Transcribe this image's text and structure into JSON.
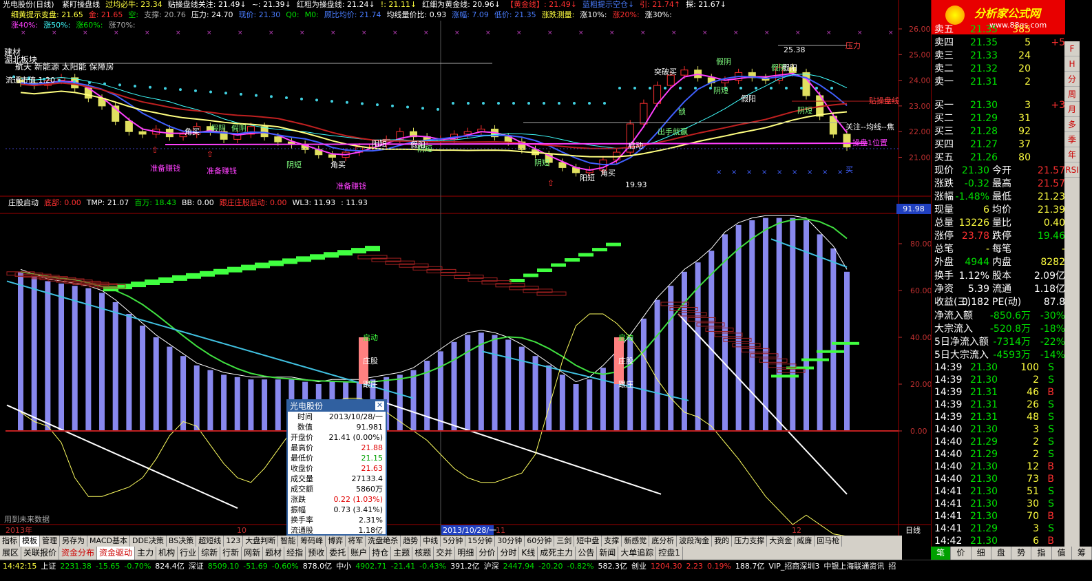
{
  "header": {
    "title": "光电股份(日线)",
    "line1": [
      {
        "t": "紧盯操盘线",
        "c": "wht"
      },
      {
        "t": "过均必牛: 23.34",
        "c": "yel"
      },
      {
        "t": "贴操盘线关注: 21.49↓",
        "c": "wht"
      },
      {
        "t": "~: 21.39↓",
        "c": "wht"
      },
      {
        "t": "红粗为操盘线: 21.24↓",
        "c": "wht"
      },
      {
        "t": "!: 21.11↓",
        "c": "yel"
      },
      {
        "t": "红细为黄金线: 20.96↓",
        "c": "wht"
      },
      {
        "t": "【黄金线】: 21.49↓",
        "c": "red"
      },
      {
        "t": "蓝粗提示空仓↓",
        "c": "blu"
      },
      {
        "t": "引: 21.74↑",
        "c": "red"
      },
      {
        "t": "探: 21.67↓",
        "c": "wht"
      }
    ],
    "line2": [
      {
        "t": "细黄提示变盘: 21.65",
        "c": "yel"
      },
      {
        "t": "金: 21.65",
        "c": "red"
      },
      {
        "t": "空:",
        "c": "grn"
      },
      {
        "t": "支撑: 20.76",
        "c": "gry"
      },
      {
        "t": "压力: 24.70",
        "c": "wht"
      },
      {
        "t": "现价: 21.30",
        "c": "blu"
      },
      {
        "t": "Q0:",
        "c": "grn"
      },
      {
        "t": "M0:",
        "c": "grn"
      },
      {
        "t": "顾比均价: 21.74",
        "c": "blu"
      },
      {
        "t": "均线量价比: 0.93",
        "c": "wht"
      },
      {
        "t": "涨幅: 7.09",
        "c": "blu"
      },
      {
        "t": "低价: 21.35",
        "c": "blu"
      },
      {
        "t": "涨跌测量:",
        "c": "yel"
      },
      {
        "t": "涨10%:",
        "c": "wht"
      },
      {
        "t": "涨20%:",
        "c": "red"
      },
      {
        "t": "涨30%:",
        "c": "wht"
      }
    ],
    "line3": [
      {
        "t": "涨40%:",
        "c": "mag"
      },
      {
        "t": "涨50%:",
        "c": "cyn"
      },
      {
        "t": "涨60%:",
        "c": "grn"
      },
      {
        "t": "涨70%:",
        "c": "gry"
      }
    ]
  },
  "overlay_texts": {
    "sector1": "建材",
    "sector2": "湖北板块",
    "concepts": "航天 新能源 太阳能 保障房",
    "note": "流通市值 1.20",
    "future_data": "用到未来数据"
  },
  "indicator_header": [
    {
      "t": "庄股启动",
      "c": "wht"
    },
    {
      "t": "底部: 0.00",
      "c": "red"
    },
    {
      "t": "TMP: 21.07",
      "c": "wht"
    },
    {
      "t": "百万: 18.43",
      "c": "grn"
    },
    {
      "t": "BB: 0.00",
      "c": "wht"
    },
    {
      "t": "跟庄庄股启动: 0.00",
      "c": "red"
    },
    {
      "t": "WL3: 11.93",
      "c": "wht"
    },
    {
      "t": ": 11.93",
      "c": "wht"
    }
  ],
  "price_axis": [
    "26.00",
    "25.00",
    "24.00",
    "23.00",
    "22.00",
    "21.00"
  ],
  "ind_axis": [
    "80.00",
    "60.00",
    "40.00",
    "20.00",
    "0.00"
  ],
  "ind_cursor_value": "91.98",
  "chart_labels": {
    "peak": "25.38",
    "low": "19.93",
    "yl": "压力",
    "cpx": "贴操盘线",
    "gz": "关注--均线--焦",
    "wz": "操盘1位置",
    "buy": "买",
    "qd1": "启动",
    "zg1": "庄股",
    "gz1": "跟庄",
    "qd2": "启动",
    "zg2": "庄股",
    "gz2": "跟庄",
    "xs": [
      "准备赚钱",
      "准备赚钱",
      "准备赚钱"
    ],
    "signals": [
      "角买",
      "假阴",
      "阴短",
      "阴短",
      "角买",
      "假阴",
      "阳短",
      "假阳",
      "阴短",
      "阳短",
      "角买",
      "突破买",
      "出手就赢",
      "锁",
      "假阴",
      "阴短",
      "假阳",
      "假阴",
      "假阳",
      "阴短",
      "启动"
    ]
  },
  "time_axis": {
    "y2013": "2013年",
    "m10": "10",
    "cursor": "2013/10/28/一",
    "m11": "11",
    "m12": "12",
    "mode": "日线"
  },
  "tabs1": [
    "指标",
    "模板",
    "管理",
    "另存为",
    "MACD基本",
    "DDE决策",
    "BS决策",
    "超短线",
    "123",
    "大盘判断",
    "智能",
    "筹码峰",
    "博弈",
    "将军",
    "洗盘绝杀",
    "趋势",
    "中线",
    "5分钟",
    "15分钟",
    "30分钟",
    "60分钟",
    "三剑",
    "短中盘",
    "支撑",
    "新感觉",
    "底分析",
    "波段淘金",
    "我的",
    "压力支撑",
    "大资金",
    "威廉",
    "回马枪"
  ],
  "tabs2": [
    "展区",
    "关联报价",
    "资金分布",
    "资金驱动",
    "主力",
    "机构",
    "行业",
    "综新",
    "行新",
    "网新",
    "题材",
    "经指",
    "预收",
    "委托",
    "账户",
    "持仓",
    "主题",
    "核题",
    "交并",
    "明细",
    "分价",
    "分时",
    "K线",
    "成死主力",
    "公告",
    "新闻",
    "大单追踪",
    "控盘1"
  ],
  "popup": {
    "title": "光电股份",
    "rows": [
      [
        "时间",
        "2013/10/28/一"
      ],
      [
        "数值",
        "91.981"
      ],
      [
        "开盘价",
        "21.41 (0.00%)"
      ],
      [
        "最高价",
        "21.88"
      ],
      [
        "最低价",
        "21.15"
      ],
      [
        "收盘价",
        "21.63"
      ],
      [
        "成交量",
        "27133.4"
      ],
      [
        "成交额",
        "5860万"
      ],
      [
        "涨跌",
        "0.22 (1.03%)"
      ],
      [
        "振幅",
        "0.73 (3.41%)"
      ],
      [
        "换手率",
        "2.31%"
      ],
      [
        "流通股",
        "1.18亿"
      ]
    ],
    "colors": [
      "#000",
      "#000",
      "#000",
      "#e00000",
      "#00a000",
      "#e00000",
      "#000",
      "#000",
      "#e00000",
      "#000",
      "#000",
      "#000"
    ]
  },
  "panel": {
    "logo": "分析家公式网",
    "url": "www.88gs.com",
    "asks": [
      [
        "卖五",
        "21.35",
        "385",
        ""
      ],
      [
        "卖四",
        "21.35",
        "5",
        "+5"
      ],
      [
        "卖三",
        "21.33",
        "24",
        ""
      ],
      [
        "卖二",
        "21.32",
        "20",
        ""
      ],
      [
        "卖一",
        "21.31",
        "2",
        ""
      ]
    ],
    "bids": [
      [
        "买一",
        "21.30",
        "3",
        "+3"
      ],
      [
        "买二",
        "21.29",
        "31",
        ""
      ],
      [
        "买三",
        "21.28",
        "92",
        ""
      ],
      [
        "买四",
        "21.27",
        "37",
        ""
      ],
      [
        "买五",
        "21.26",
        "80",
        ""
      ]
    ],
    "stats": [
      [
        "现价",
        "21.30",
        "今开",
        "21.57"
      ],
      [
        "涨跌",
        "-0.32",
        "最高",
        "21.57"
      ],
      [
        "涨幅",
        "-1.48%",
        "最低",
        "21.23"
      ],
      [
        "现量",
        "6",
        "均价",
        "21.39"
      ],
      [
        "总量",
        "13226",
        "量比",
        "0.40"
      ],
      [
        "涨停",
        "23.78",
        "跌停",
        "19.46"
      ],
      [
        "总笔",
        "-",
        "每笔",
        "-"
      ],
      [
        "外盘",
        "4944",
        "内盘",
        "8282"
      ]
    ],
    "stats2": [
      [
        "换手",
        "1.12%",
        "股本",
        "2.09亿"
      ],
      [
        "净资",
        "5.39",
        "流通",
        "1.18亿"
      ],
      [
        "收益(三)",
        "0.182",
        "PE(动)",
        "87.8"
      ]
    ],
    "flows": [
      [
        "净流入额",
        "-850.6万",
        "-30%"
      ],
      [
        "大宗流入",
        "-520.8万",
        "-18%"
      ],
      [
        "5日净流入额",
        "-7314万",
        "-22%"
      ],
      [
        "5日大宗流入",
        "-4593万",
        "-14%"
      ]
    ],
    "ticks": [
      [
        "14:39",
        "21.30",
        "100",
        "S"
      ],
      [
        "14:39",
        "21.30",
        "2",
        "S"
      ],
      [
        "14:39",
        "21.31",
        "46",
        "B"
      ],
      [
        "14:39",
        "21.31",
        "26",
        "S"
      ],
      [
        "14:39",
        "21.31",
        "48",
        "S"
      ],
      [
        "14:40",
        "21.30",
        "3",
        "S"
      ],
      [
        "14:40",
        "21.29",
        "2",
        "S"
      ],
      [
        "14:40",
        "21.29",
        "2",
        "S"
      ],
      [
        "14:40",
        "21.30",
        "12",
        "B"
      ],
      [
        "14:40",
        "21.30",
        "73",
        "B"
      ],
      [
        "14:41",
        "21.30",
        "51",
        "S"
      ],
      [
        "14:41",
        "21.30",
        "30",
        "S"
      ],
      [
        "14:41",
        "21.30",
        "70",
        "B"
      ],
      [
        "14:41",
        "21.29",
        "3",
        "S"
      ],
      [
        "14:42",
        "21.30",
        "6",
        "B"
      ]
    ],
    "tabs": [
      "笔",
      "价",
      "细",
      "盘",
      "势",
      "指",
      "值",
      "筹"
    ],
    "side": [
      "F",
      "H",
      "分",
      "周",
      "月",
      "多",
      "季",
      "年",
      "RSI"
    ]
  },
  "status": [
    {
      "t": "14:42:15",
      "c": "yel"
    },
    {
      "t": "上证",
      "c": "wht"
    },
    {
      "t": "2231.38",
      "c": "grn"
    },
    {
      "t": "-15.65",
      "c": "grn"
    },
    {
      "t": "-0.70%",
      "c": "grn"
    },
    {
      "t": "824.4亿",
      "c": "wht"
    },
    {
      "t": "深证",
      "c": "wht"
    },
    {
      "t": "8509.10",
      "c": "grn"
    },
    {
      "t": "-51.69",
      "c": "grn"
    },
    {
      "t": "-0.60%",
      "c": "grn"
    },
    {
      "t": "878.0亿",
      "c": "wht"
    },
    {
      "t": "中小",
      "c": "wht"
    },
    {
      "t": "4902.71",
      "c": "grn"
    },
    {
      "t": "-21.41",
      "c": "grn"
    },
    {
      "t": "-0.43%",
      "c": "grn"
    },
    {
      "t": "391.2亿",
      "c": "wht"
    },
    {
      "t": "沪深",
      "c": "wht"
    },
    {
      "t": "2447.94",
      "c": "grn"
    },
    {
      "t": "-20.20",
      "c": "grn"
    },
    {
      "t": "-0.82%",
      "c": "grn"
    },
    {
      "t": "582.3亿",
      "c": "wht"
    },
    {
      "t": "创业",
      "c": "wht"
    },
    {
      "t": "1204.30",
      "c": "red"
    },
    {
      "t": "2.23",
      "c": "red"
    },
    {
      "t": "0.19%",
      "c": "red"
    },
    {
      "t": "188.7亿",
      "c": "wht"
    },
    {
      "t": "VIP_招商深圳3",
      "c": "wht"
    },
    {
      "t": "中银上海联通资讯",
      "c": "wht"
    },
    {
      "t": "招",
      "c": "wht"
    }
  ]
}
